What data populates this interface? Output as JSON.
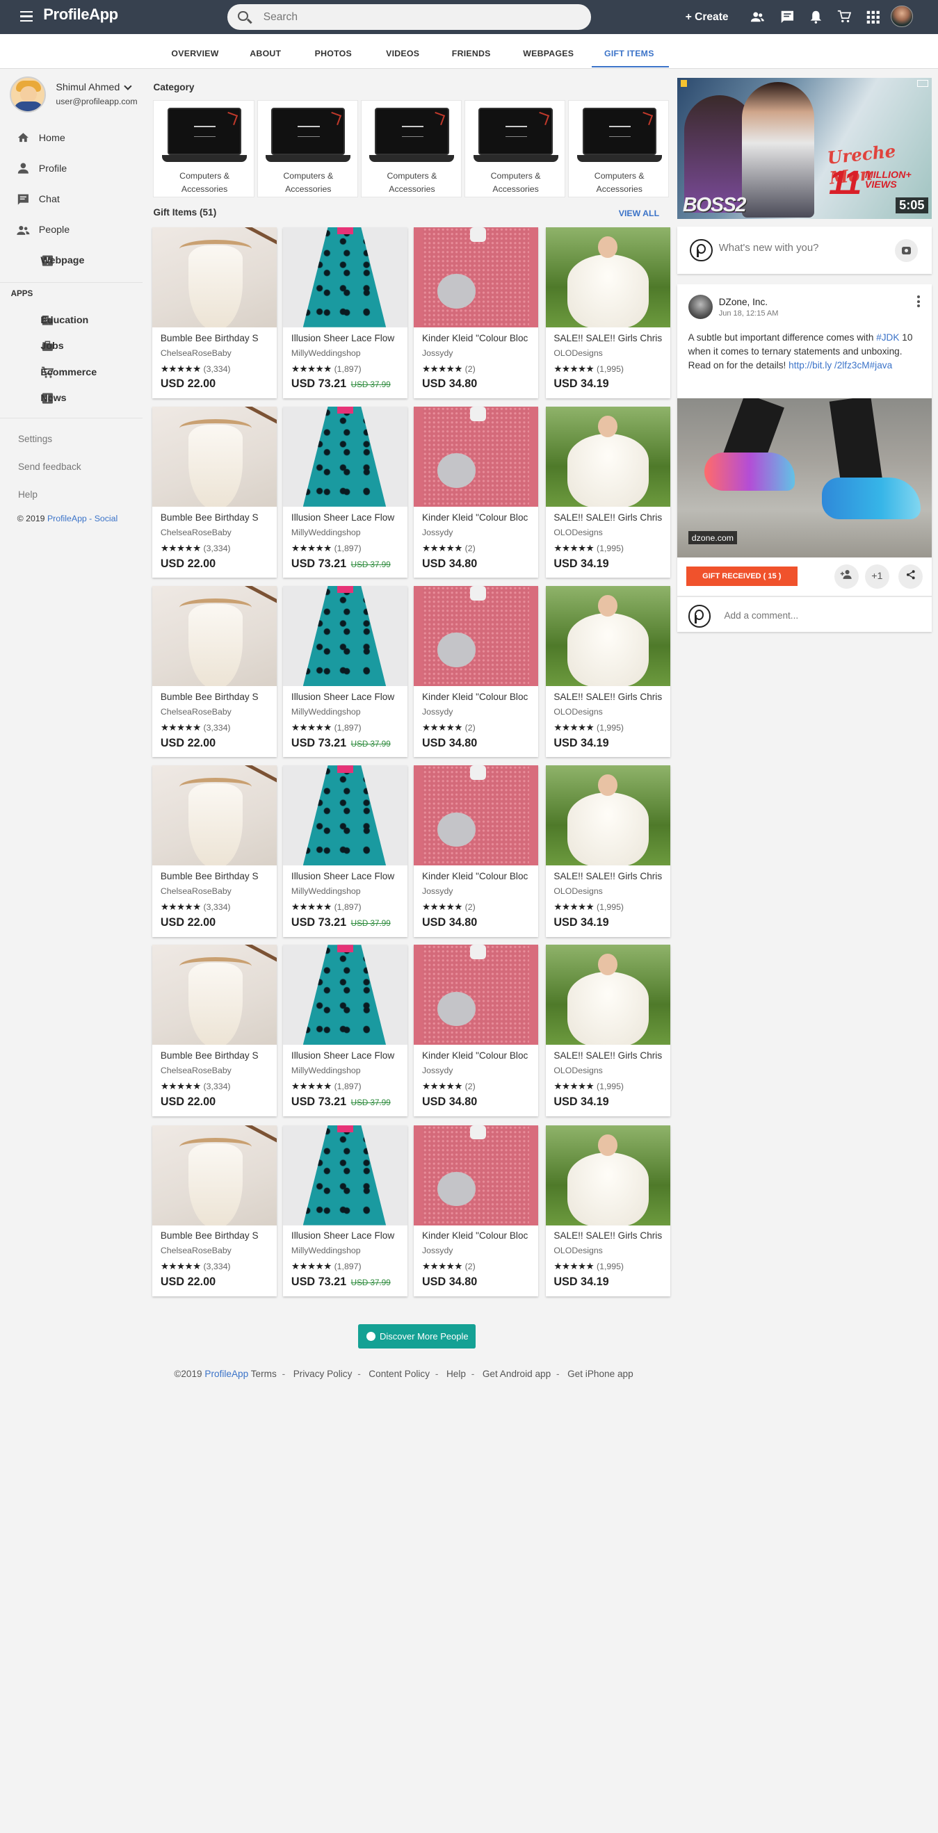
{
  "app": {
    "name": "ProfileApp",
    "search_placeholder": "Search",
    "create_label": "+ Create"
  },
  "header_icons": [
    "people-icon",
    "chat-icon",
    "bell-icon",
    "cart-icon",
    "apps-icon"
  ],
  "tabs": [
    "OVERVIEW",
    "ABOUT",
    "PHOTOS",
    "VIDEOS",
    "FRIENDS",
    "WEBPAGES",
    "GIFT ITEMS"
  ],
  "active_tab": "GIFT ITEMS",
  "user": {
    "name": "Shimul Ahmed",
    "email": "user@profileapp.com"
  },
  "nav": {
    "main": [
      {
        "label": "Home",
        "icon": "home-icon"
      },
      {
        "label": "Profile",
        "icon": "person-icon"
      },
      {
        "label": "Chat",
        "icon": "chat-icon"
      },
      {
        "label": "People",
        "icon": "people-icon"
      },
      {
        "label": "Webpage",
        "icon": "webpage-icon"
      }
    ],
    "apps_header": "APPS",
    "apps": [
      {
        "label": "Education",
        "icon": "building-icon"
      },
      {
        "label": "Jobs",
        "icon": "briefcase-icon"
      },
      {
        "label": "Ecommerce",
        "icon": "cart-icon"
      },
      {
        "label": "News",
        "icon": "news-icon"
      }
    ],
    "secondary": [
      "Settings",
      "Send feedback",
      "Help"
    ],
    "copyright": "© 2019",
    "copyright_link": "ProfileApp - Social"
  },
  "category": {
    "title": "Category",
    "items": [
      {
        "l1": "Computers &",
        "l2": "Accessories"
      },
      {
        "l1": "Computers &",
        "l2": "Accessories"
      },
      {
        "l1": "Computers &",
        "l2": "Accessories"
      },
      {
        "l1": "Computers &",
        "l2": "Accessories"
      },
      {
        "l1": "Computers &",
        "l2": "Accessories"
      }
    ]
  },
  "gifts": {
    "title": "Gift Items (51)",
    "view_all": "VIEW ALL",
    "products": [
      {
        "name": "Bumble Bee Birthday S",
        "shop": "ChelseaRoseBaby",
        "stars": "★★★★★",
        "count": "(3,334)",
        "price": "USD 22.00",
        "old": ""
      },
      {
        "name": "Illusion Sheer Lace Flow",
        "shop": "MillyWeddingshop",
        "stars": "★★★★★",
        "count": "(1,897)",
        "price": "USD 73.21",
        "old": "USD 37.99"
      },
      {
        "name": "Kinder Kleid \"Colour Bloc",
        "shop": "Jossydy",
        "stars": "★★★★★",
        "count": "(2)",
        "price": "USD 34.80",
        "old": ""
      },
      {
        "name": "SALE!! SALE!! Girls Christ",
        "shop": "OLODesigns",
        "stars": "★★★★★",
        "count": "(1,995)",
        "price": "USD 34.19",
        "old": ""
      }
    ]
  },
  "ad": {
    "line1": "Ureche Mon",
    "big": "11",
    "small1": "MILLION+",
    "small2": "VIEWS",
    "film": "BOSS2",
    "duration": "5:05"
  },
  "composer": {
    "placeholder": "What's new with you?"
  },
  "post": {
    "author": "DZone, Inc.",
    "date": "Jun 18, 12:15 AM",
    "text_a": "A subtle but important difference comes with ",
    "tag1": "#JDK",
    "text_b": " 10 when it comes to ternary statements and unboxing. Read on for the details! ",
    "link": "http://bit.ly /2lfz3cM#java",
    "image_tag": "dzone.com",
    "gift_button": "GIFT RECEIVED ( 15 )",
    "plus_one": "+1",
    "comment_placeholder": "Add a comment..."
  },
  "discover_button": "Discover More People",
  "footer": {
    "copyright": "©2019",
    "brand": "ProfileApp",
    "links": [
      "Terms",
      "Privacy Policy",
      "Content Policy",
      "Help",
      "Get Android app",
      "Get iPhone app"
    ]
  }
}
